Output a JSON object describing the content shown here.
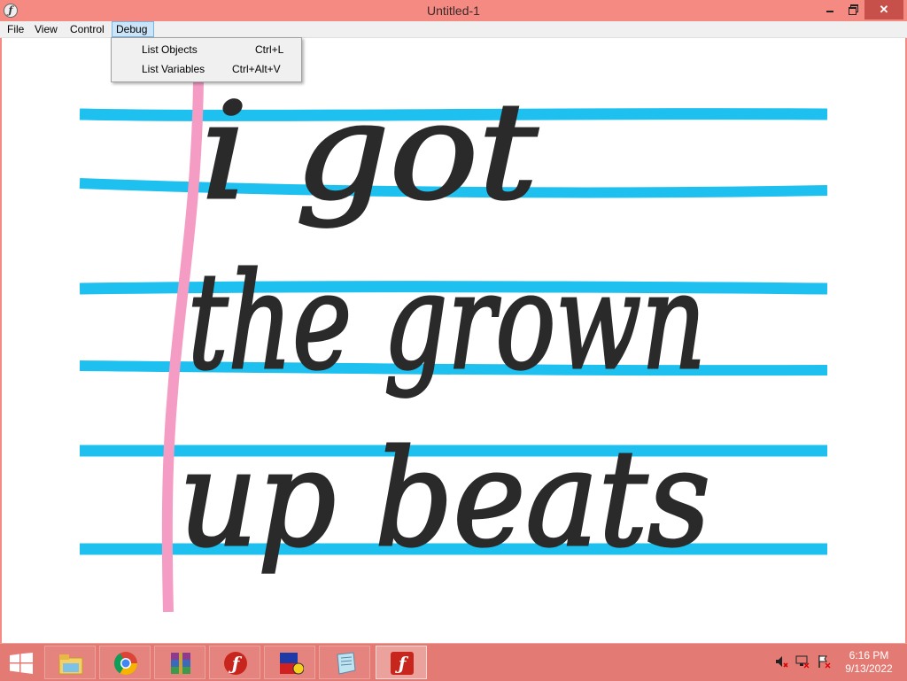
{
  "window": {
    "title": "Untitled-1",
    "icon": "flash-player-icon",
    "controls": {
      "minimize": "minimize",
      "maximize": "restore",
      "close": "✕"
    }
  },
  "menubar": {
    "items": [
      {
        "label": "File"
      },
      {
        "label": "View"
      },
      {
        "label": "Control"
      },
      {
        "label": "Debug"
      }
    ]
  },
  "debug_menu": {
    "items": [
      {
        "label": "List Objects",
        "shortcut": "Ctrl+L"
      },
      {
        "label": "List Variables",
        "shortcut": "Ctrl+Alt+V"
      }
    ]
  },
  "canvas": {
    "background": "#ffffff",
    "line_color": "#1ec0ef",
    "margin_color": "#f59cc4",
    "ink_color": "#2a2a2a",
    "handwriting": [
      "i got",
      "the grown",
      "up beats"
    ]
  },
  "taskbar": {
    "apps": [
      {
        "name": "file-explorer-icon"
      },
      {
        "name": "chrome-icon"
      },
      {
        "name": "winrar-icon"
      },
      {
        "name": "flash-icon"
      },
      {
        "name": "mb-icon"
      },
      {
        "name": "notepad-icon"
      },
      {
        "name": "flash-player-icon"
      }
    ],
    "tray": {
      "volume": "muted",
      "network": "network-icon",
      "flag": "action-center-icon"
    },
    "clock": {
      "time": "6:16 PM",
      "date": "9/13/2022"
    }
  },
  "colors": {
    "titlebar": "#f58a83",
    "taskbar": "#e37a73",
    "close": "#c7504a",
    "menu_highlight": "#cce4f7"
  }
}
